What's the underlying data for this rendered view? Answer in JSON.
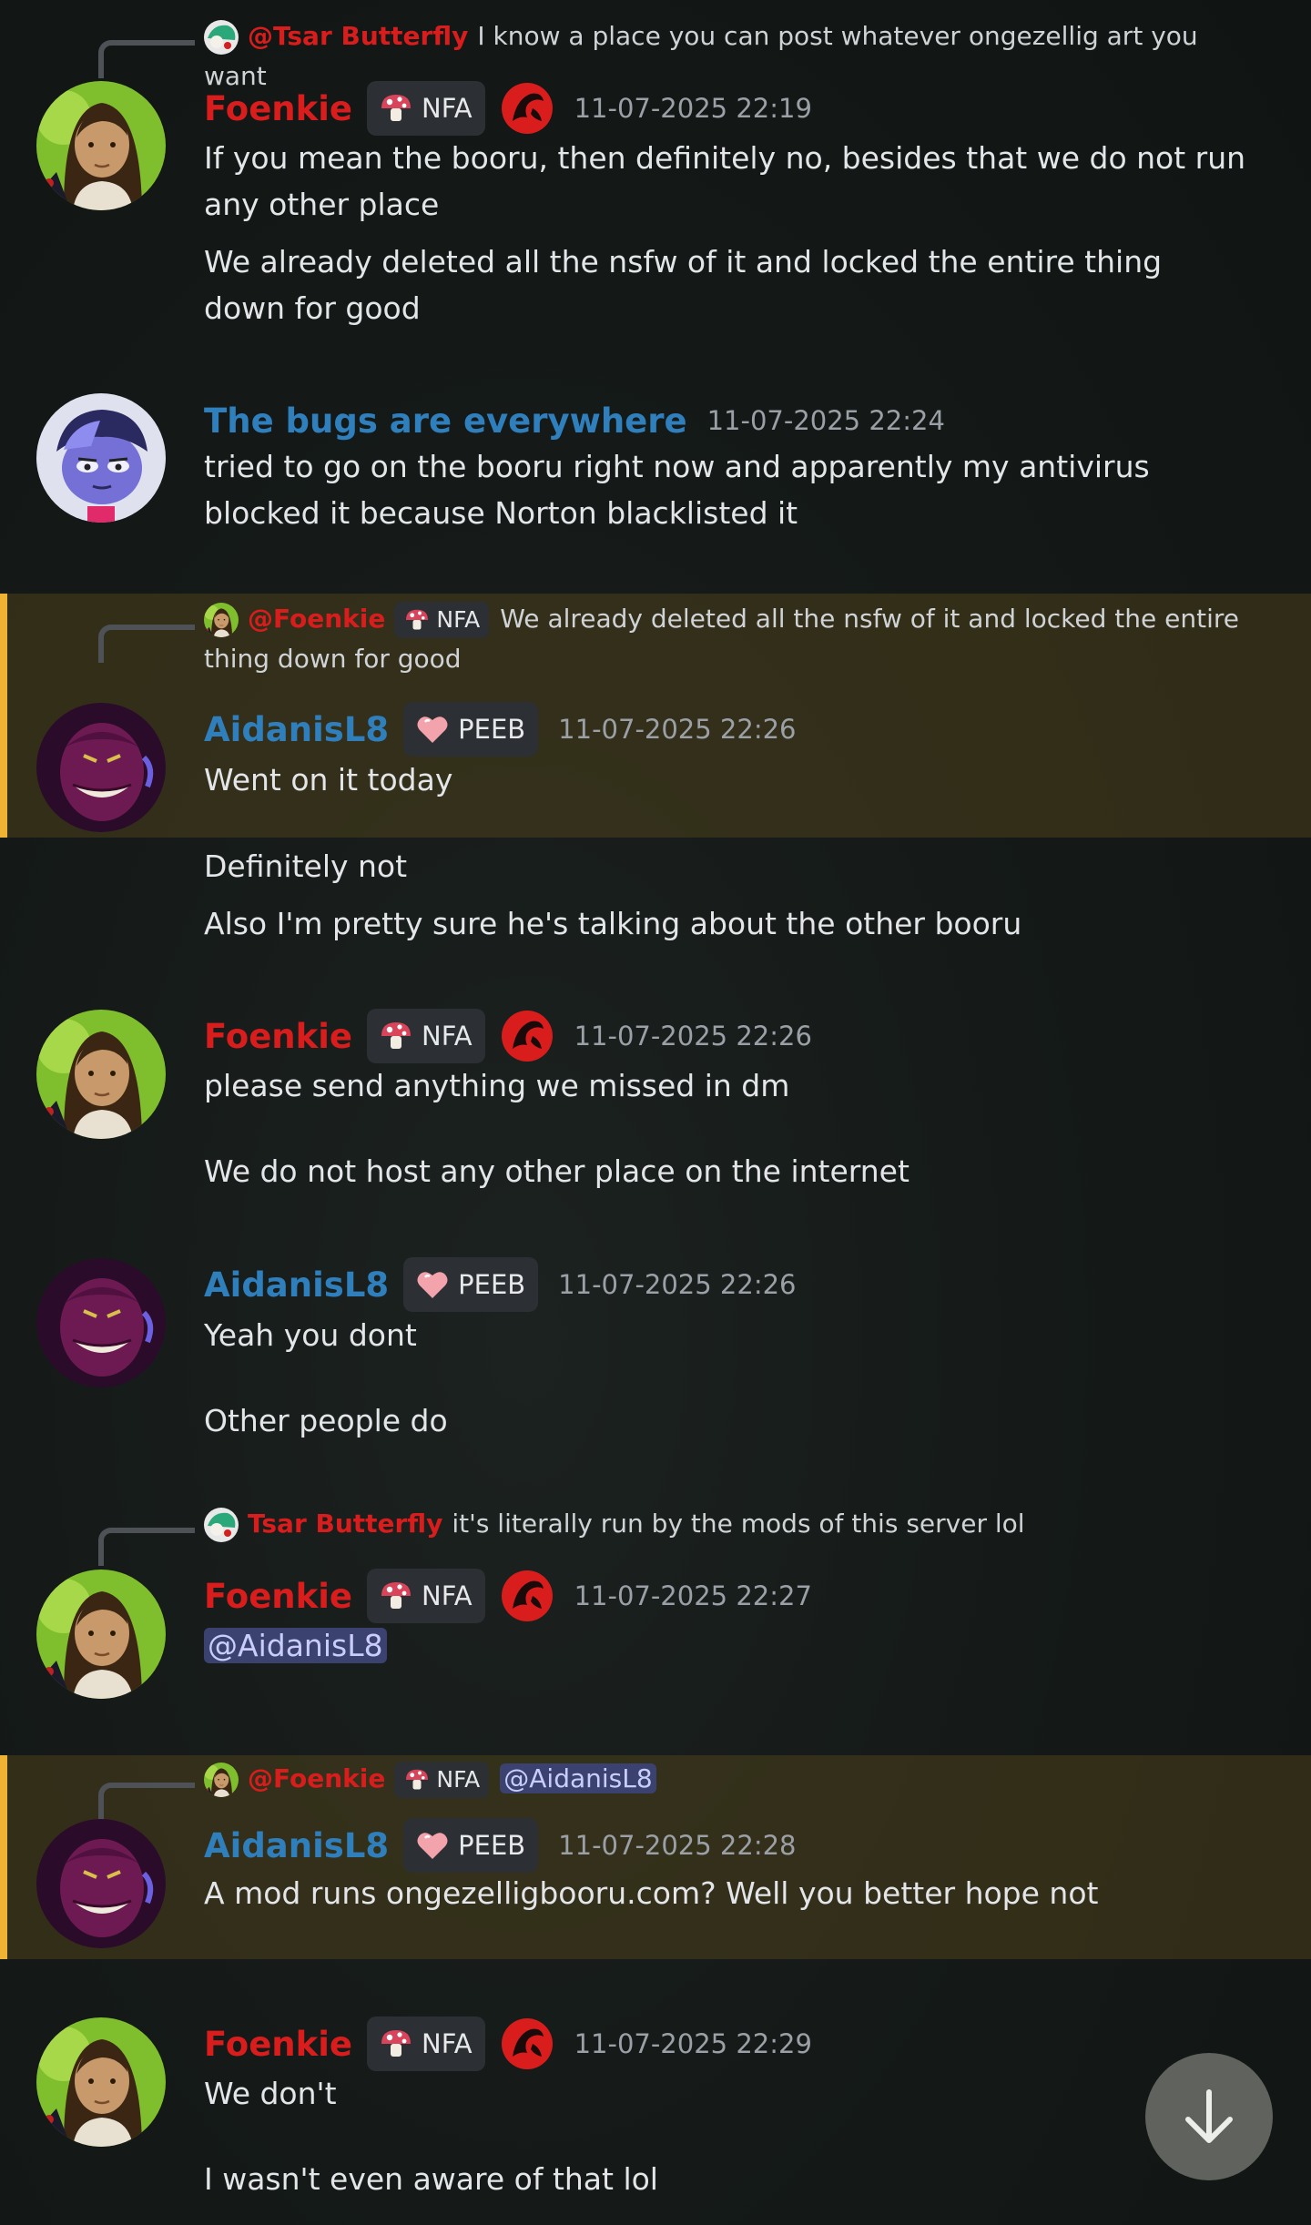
{
  "colors": {
    "username_red": "#d91d1d",
    "username_blue": "#2f7fbd",
    "highlight": "#f0b232",
    "mention_bg": "#3c4270"
  },
  "messages": [
    {
      "reply": {
        "author": "@Tsar Butterfly",
        "text": "I know a place you can post whatever ongezellig art you want"
      },
      "author": "Foenkie",
      "tag": "NFA",
      "time": "11-07-2025 22:19",
      "lines": [
        "If you mean the booru, then definitely no, besides that we do not run any other place",
        "We already deleted all the nsfw of it and locked the entire thing down for good"
      ]
    },
    {
      "author": "The bugs are everywhere",
      "time": "11-07-2025 22:24",
      "lines": [
        "tried to go on the booru right now and apparently my antivirus blocked it because Norton blacklisted it"
      ]
    },
    {
      "reply": {
        "author": "@Foenkie",
        "tag": "NFA",
        "text": "We already deleted all the nsfw of it and locked the entire thing down for good"
      },
      "author": "AidanisL8",
      "tag": "PEEB",
      "time": "11-07-2025 22:26",
      "lines": [
        "Went on it today",
        "Definitely not",
        "Also I'm pretty sure he's talking about the other booru"
      ]
    },
    {
      "author": "Foenkie",
      "tag": "NFA",
      "time": "11-07-2025 22:26",
      "lines": [
        "please send anything we missed in dm",
        "We do not host any other place on the internet"
      ]
    },
    {
      "author": "AidanisL8",
      "tag": "PEEB",
      "time": "11-07-2025 22:26",
      "lines": [
        "Yeah you dont",
        "Other people do"
      ]
    },
    {
      "reply": {
        "author": "Tsar Butterfly",
        "text": "it's literally run by the mods of this server lol"
      },
      "author": "Foenkie",
      "tag": "NFA",
      "time": "11-07-2025 22:27",
      "lines": [
        "@AidanisL8"
      ]
    },
    {
      "reply": {
        "author": "@Foenkie",
        "tag": "NFA",
        "text": "@AidanisL8"
      },
      "author": "AidanisL8",
      "tag": "PEEB",
      "time": "11-07-2025 22:28",
      "lines": [
        "A mod runs ongezelligbooru.com? Well you better hope not"
      ]
    },
    {
      "author": "Foenkie",
      "tag": "NFA",
      "time": "11-07-2025 22:29",
      "lines": [
        "We don't",
        "I wasn't even aware of that lol"
      ]
    }
  ],
  "icons": {
    "scroll_down": "arrow-down-icon",
    "mushroom": "mushroom-icon",
    "heart": "heart-icon",
    "role": "hollow-knight-icon"
  }
}
